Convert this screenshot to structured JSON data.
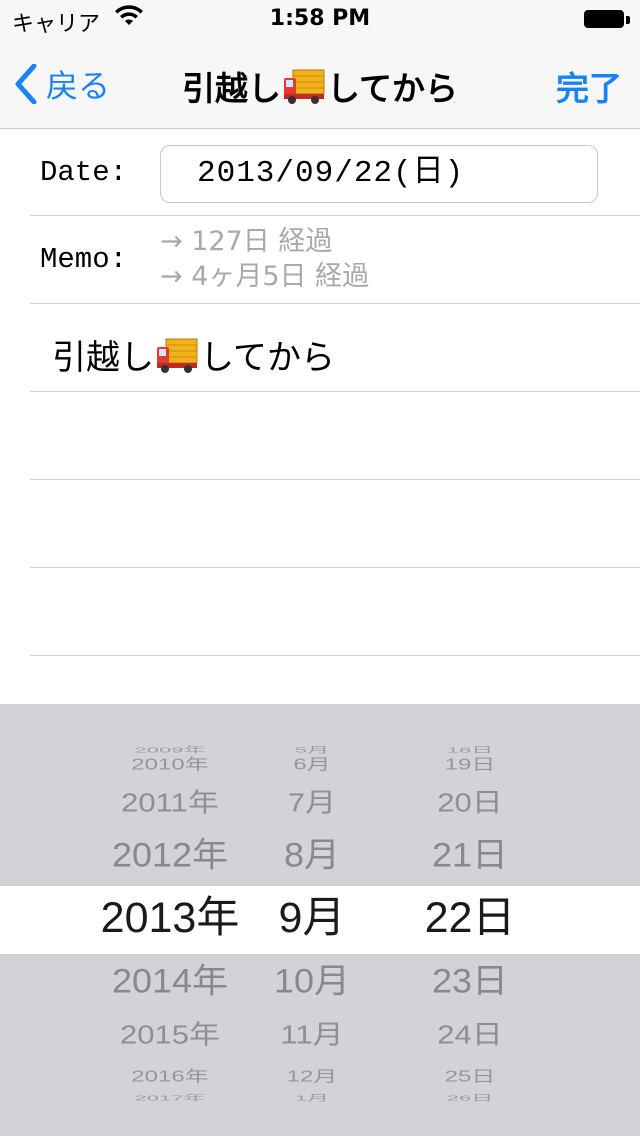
{
  "status_bar": {
    "carrier": "キャリア",
    "time": "1:58 PM"
  },
  "nav": {
    "back_label": "戻る",
    "title_prefix": "引越し",
    "title_suffix": "してから",
    "done_label": "完了"
  },
  "form": {
    "date_label": "Date:",
    "date_value": "2013/09/22(日)",
    "memo_label": "Memo:",
    "memo_lines": [
      "→ 127日 経過",
      "→ 4ヶ月5日 経過"
    ],
    "note_prefix": "引越し",
    "note_suffix": "してから"
  },
  "picker": {
    "years": [
      "2009年",
      "2010年",
      "2011年",
      "2012年",
      "2013年",
      "2014年",
      "2015年",
      "2016年",
      "2017年"
    ],
    "months": [
      "5月",
      "6月",
      "7月",
      "8月",
      "9月",
      "10月",
      "11月",
      "12月",
      "1月"
    ],
    "days": [
      "18日",
      "19日",
      "20日",
      "21日",
      "22日",
      "23日",
      "24日",
      "25日",
      "26日"
    ],
    "selected_index": 4
  },
  "colors": {
    "accent": "#1a82f7",
    "picker_bg": "#d1d3d8",
    "memo_text": "#a9a9a9"
  }
}
